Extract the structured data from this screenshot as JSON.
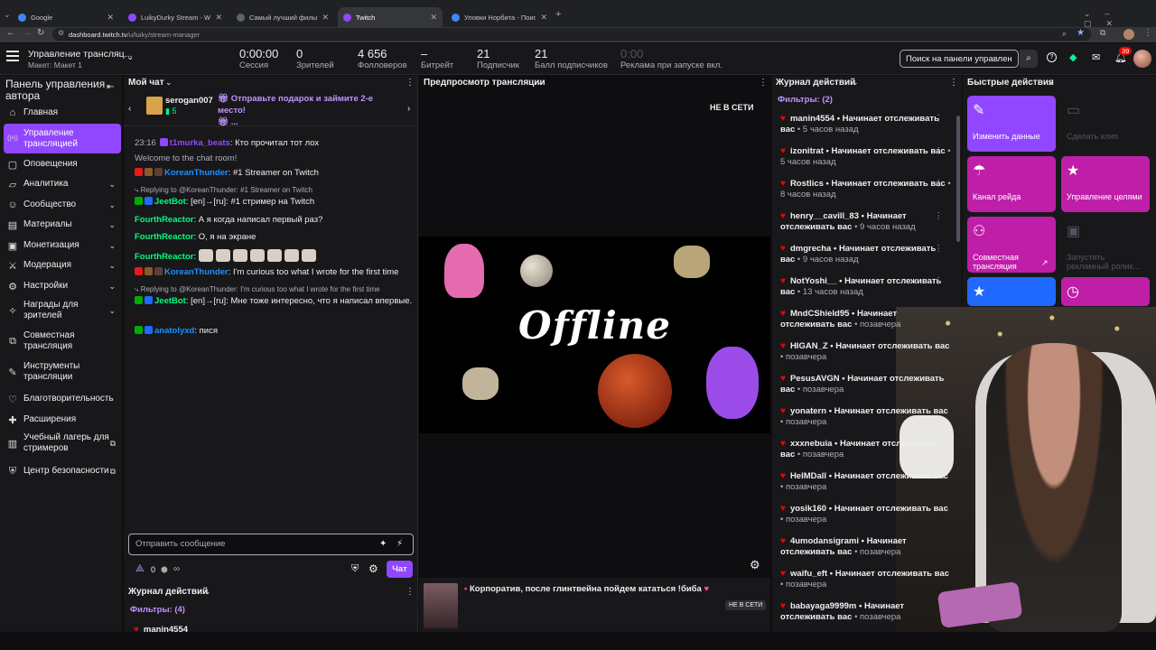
{
  "browser": {
    "tabs": [
      {
        "label": "Google",
        "color": "#4285f4"
      },
      {
        "label": "LuikyDurky Stream - Watch Li...",
        "color": "#9147ff"
      },
      {
        "label": "Самый лучший фильм",
        "color": "#5f6368"
      },
      {
        "label": "Twitch",
        "color": "#9147ff"
      },
      {
        "label": "Уловки Норбита - Поиск в Go...",
        "color": "#4285f4"
      }
    ],
    "url_domain": "dashboard.twitch.tv",
    "url_path": "/u/luiky/stream-manager"
  },
  "header": {
    "title": "Управление трансляц...",
    "subtitle": "Макет: Макет 1",
    "search_placeholder": "Поиск на панели управлен",
    "notif_count": "39",
    "stats": [
      {
        "value": "0:00:00",
        "label": "Сессия"
      },
      {
        "value": "0",
        "label": "Зрителей"
      },
      {
        "value": "4 656",
        "label": "Фолловеров"
      },
      {
        "value": "–",
        "label": "Битрейт"
      },
      {
        "value": "21",
        "label": "Подписчик"
      },
      {
        "value": "21",
        "label": "Балл подписчиков"
      },
      {
        "value": "0:00",
        "label": "Реклама при запуске вкл."
      }
    ]
  },
  "sidebar": {
    "title": "Панель управления автора",
    "items": [
      {
        "label": "Главная",
        "icon": "home-icon"
      },
      {
        "label": "Управление трансляцией",
        "icon": "broadcast-icon",
        "active": true
      },
      {
        "label": "Оповещения",
        "icon": "bell-icon"
      },
      {
        "label": "Аналитика",
        "icon": "chart-icon",
        "chevron": true
      },
      {
        "label": "Сообщество",
        "icon": "people-icon",
        "chevron": true
      },
      {
        "label": "Материалы",
        "icon": "folder-icon",
        "chevron": true
      },
      {
        "label": "Монетизация",
        "icon": "money-icon",
        "chevron": true
      },
      {
        "label": "Модерация",
        "icon": "sword-icon",
        "chevron": true
      },
      {
        "label": "Настройки",
        "icon": "gear-icon",
        "chevron": true
      },
      {
        "label": "Награды для зрителей",
        "icon": "gift-icon",
        "chevron": true
      },
      {
        "label": "Совместная трансляция",
        "icon": "coop-icon"
      },
      {
        "label": "Инструменты трансляции",
        "icon": "tools-icon"
      },
      {
        "label": "Благотворительность",
        "icon": "heart-icon"
      },
      {
        "label": "Расширения",
        "icon": "puzzle-icon"
      },
      {
        "label": "Учебный лагерь для стримеров",
        "icon": "book-icon",
        "external": true
      },
      {
        "label": "Центр безопасности",
        "icon": "shield-icon",
        "external": true
      }
    ]
  },
  "chat": {
    "title": "Мой чат",
    "gift_user": "serogan007",
    "gift_count": "5",
    "gift_text": "Отправьте подарок и займите 2-е место!",
    "gift_more": "...",
    "messages": [
      {
        "time": "23:16",
        "user": "t1murka_beats",
        "color": "#9147ff",
        "text": ": Кто прочитал тот лох"
      },
      {
        "system": "Welcome to the chat room!"
      },
      {
        "user": "KoreanThunder",
        "color": "#1e90ff",
        "text": ": #1 Streamer on Twitch"
      },
      {
        "reply": "Replying to @KoreanThunder: #1 Streamer on Twitch"
      },
      {
        "user": "JeetBot",
        "color": "#00ff7f",
        "text": ": [en]→[ru]: #1 стример на Twitch"
      },
      {
        "user": "FourthReactor",
        "color": "#00ff7f",
        "text": ": А я когда написал первый раз?"
      },
      {
        "user": "FourthReactor",
        "color": "#00ff7f",
        "text": ": О, я на экране"
      },
      {
        "user": "FourthReactor",
        "color": "#00ff7f",
        "text": ":"
      },
      {
        "user": "KoreanThunder",
        "color": "#1e90ff",
        "text": ": I'm curious too what I wrote for the first time"
      },
      {
        "reply": "Replying to @KoreanThunder: I'm curious too what I wrote for the first time"
      },
      {
        "user": "JeetBot",
        "color": "#00ff7f",
        "text": ": [en]→[ru]: Мне тоже интересно, что я написал впервые."
      },
      {
        "user": "anatolyxd",
        "color": "#1e90ff",
        "text": ": пися"
      }
    ],
    "input_placeholder": "Отправить сообщение",
    "points": "0",
    "infinity": "∞",
    "send_label": "Чат"
  },
  "journal_bottom": {
    "title": "Журнал действий",
    "filters": "Фильтры: (4)",
    "first": "manin4554"
  },
  "preview": {
    "title": "Предпросмотр трансляции",
    "status": "НЕ В СЕТИ",
    "offline_text": "Offline",
    "stream_title": "Корпоратив, после глинтвейна пойдем кататься !бибa",
    "bottom_status": "НЕ В СЕТИ"
  },
  "journal": {
    "title": "Журнал действий",
    "filters": "Фильтры: (2)",
    "items": [
      {
        "name": "manin4554",
        "action": " • Начинает отслеживать вас",
        "time": " • 5 часов назад"
      },
      {
        "name": "izonitrat",
        "action": " • Начинает отслеживать вас",
        "time": " • 5 часов назад"
      },
      {
        "name": "Rostlics",
        "action": " • Начинает отслеживать вас",
        "time": " • 8 часов назад"
      },
      {
        "name": "henry__cavill_83",
        "action": " • Начинает отслеживать вас",
        "time": " • 9 часов назад"
      },
      {
        "name": "dmgrecha",
        "action": " • Начинает отслеживать вас",
        "time": " • 9 часов назад"
      },
      {
        "name": "NotYoshi__",
        "action": " • Начинает отслеживать вас",
        "time": " • 13 часов назад"
      },
      {
        "name": "MndCShield95",
        "action": " • Начинает отслеживать вас",
        "time": " • позавчера"
      },
      {
        "name": "HIGAN_Z",
        "action": " • Начинает отслеживать вас",
        "time": " • позавчера"
      },
      {
        "name": "PesusAVGN",
        "action": " • Начинает отслеживать вас",
        "time": " • позавчера"
      },
      {
        "name": "yonatern",
        "action": " • Начинает отслеживать вас",
        "time": " • позавчера"
      },
      {
        "name": "xxxnebuia",
        "action": " • Начинает отслеживать вас",
        "time": " • позавчера"
      },
      {
        "name": "HeIMDall",
        "action": " • Начинает отслеживать вас",
        "time": " • позавчера"
      },
      {
        "name": "yosik160",
        "action": " • Начинает отслеживать вас",
        "time": " • позавчера"
      },
      {
        "name": "4umodansigrami",
        "action": " • Начинает отслеживать вас",
        "time": " • позавчера"
      },
      {
        "name": "waifu_eft",
        "action": " • Начинает отслеживать вас",
        "time": " • позавчера"
      },
      {
        "name": "babayaga9999m",
        "action": " • Начинает отслеживать вас",
        "time": " • позавчера"
      }
    ]
  },
  "quick": {
    "title": "Быстрые действия",
    "actions": [
      {
        "label": "Изменить данные",
        "color": "#9147ff",
        "icon": "pencil-icon"
      },
      {
        "label": "Сделать клип",
        "color": "#18181b",
        "icon": "clip-icon",
        "disabled": true
      },
      {
        "label": "Канал рейда",
        "color": "#bf1fa8",
        "icon": "raid-icon"
      },
      {
        "label": "Управление целями",
        "color": "#bf1fa8",
        "icon": "target-icon"
      },
      {
        "label": "Совместная трансляция",
        "color": "#bf1fa8",
        "icon": "add-user-icon"
      },
      {
        "label": "Запустить рекламный ролик...",
        "color": "#18181b",
        "icon": "ad-icon",
        "disabled": true
      },
      {
        "label": "",
        "color": "#1f69ff",
        "icon": "star-icon"
      },
      {
        "label": "",
        "color": "#bf1fa8",
        "icon": "timer-icon"
      }
    ]
  }
}
